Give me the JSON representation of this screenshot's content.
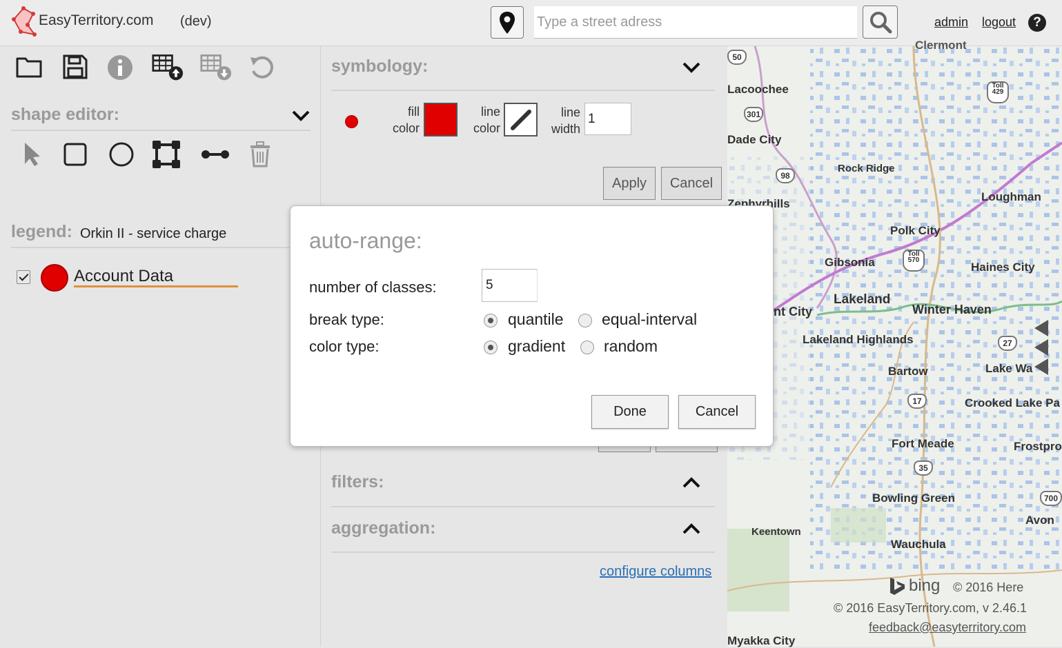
{
  "header": {
    "app_name": "EasyTerritory.com",
    "env": "(dev)",
    "address_placeholder": "Type a street adress",
    "admin_link": "admin",
    "logout_link": "logout",
    "help": "?",
    "icons": [
      "locate-pin-icon",
      "search-icon",
      "help-icon"
    ]
  },
  "left_panel": {
    "toolbar_icons": [
      "open-folder-icon",
      "save-icon",
      "info-icon",
      "table-upload-icon",
      "table-download-icon",
      "undo-icon"
    ],
    "shape_editor": {
      "title": "shape editor:",
      "tools": [
        "select-arrow-icon",
        "rectangle-icon",
        "circle-icon",
        "polygon-icon",
        "line-icon",
        "trash-icon"
      ]
    },
    "legend": {
      "title": "legend:",
      "subtitle": "Orkin II - service charge",
      "layers": [
        {
          "label": "Account Data",
          "checked": true,
          "color": "#e00000",
          "underline_color": "#e0903a"
        }
      ]
    }
  },
  "symbology": {
    "title": "symbology:",
    "fill_label_1": "fill",
    "fill_label_2": "color",
    "line_color_label_1": "line",
    "line_color_label_2": "color",
    "line_width_label_1": "line",
    "line_width_label_2": "width",
    "line_width_value": "1",
    "fill_color": "#e00000",
    "apply": "Apply",
    "cancel": "Cancel"
  },
  "filters": {
    "title": "filters:"
  },
  "aggregation": {
    "title": "aggregation:"
  },
  "configure_columns": "configure columns",
  "map": {
    "places": [
      {
        "name": "Clermont"
      },
      {
        "name": "Lacoochee"
      },
      {
        "name": "Dade City"
      },
      {
        "name": "Rock Ridge"
      },
      {
        "name": "Loughman"
      },
      {
        "name": "Zephyrhills"
      },
      {
        "name": "Polk City"
      },
      {
        "name": "Gibsonia"
      },
      {
        "name": "Haines City"
      },
      {
        "name": "Lakeland"
      },
      {
        "name": "Winter Haven"
      },
      {
        "name": "nt City"
      },
      {
        "name": "Lakeland Highlands"
      },
      {
        "name": "Bartow"
      },
      {
        "name": "Lake Wa"
      },
      {
        "name": "Crooked Lake Pa"
      },
      {
        "name": "Fort Meade"
      },
      {
        "name": "Frostpro"
      },
      {
        "name": "Bowling Green"
      },
      {
        "name": "Avon"
      },
      {
        "name": "Keentown"
      },
      {
        "name": "Wauchula"
      },
      {
        "name": "Myakka City"
      }
    ],
    "shields": [
      "50",
      "Toll 429",
      "301",
      "98",
      "Toll 570",
      "27",
      "17",
      "35",
      "700"
    ],
    "bing": "bing",
    "copyright_here": "© 2016 Here",
    "copyright_et": "© 2016 EasyTerritory.com, v 2.46.1",
    "feedback": "feedback@easyterritory.com"
  },
  "dialog": {
    "title": "auto-range:",
    "classes_label": "number of classes:",
    "classes_value": "5",
    "break_label": "break type:",
    "break_options": [
      "quantile",
      "equal-interval"
    ],
    "break_selected": "quantile",
    "color_label": "color type:",
    "color_options": [
      "gradient",
      "random"
    ],
    "color_selected": "gradient",
    "done": "Done",
    "cancel": "Cancel"
  }
}
